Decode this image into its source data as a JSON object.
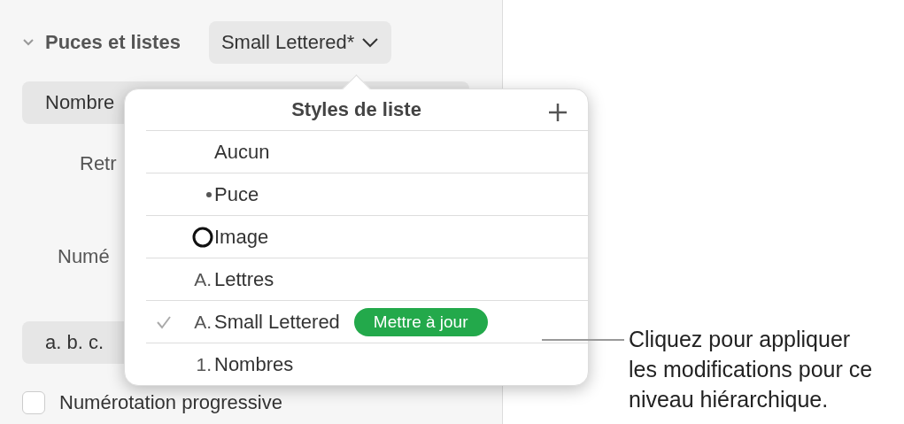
{
  "section": {
    "title": "Puces et listes",
    "expanded": true,
    "style_button": "Small Lettered*"
  },
  "sidebar": {
    "type_dropdown": "Nombre",
    "indent_label": "Retr",
    "number_label": "Numé",
    "format_field": "a. b. c.",
    "progressive": {
      "label": "Numérotation progressive",
      "checked": false
    }
  },
  "popover": {
    "title": "Styles de liste",
    "items": [
      {
        "kind": "none",
        "label": "Aucun",
        "checked": false
      },
      {
        "kind": "bullet",
        "label": "Puce",
        "checked": false
      },
      {
        "kind": "image",
        "label": "Image",
        "checked": false
      },
      {
        "kind": "text",
        "marker": "A.",
        "label": "Lettres",
        "checked": false
      },
      {
        "kind": "text",
        "marker": "A.",
        "label": "Small Lettered",
        "checked": true,
        "update_button": "Mettre à jour"
      },
      {
        "kind": "text",
        "marker": "1.",
        "label": "Nombres",
        "checked": false
      }
    ]
  },
  "callout": "Cliquez pour appliquer les modifications pour ce niveau hiérarchique."
}
